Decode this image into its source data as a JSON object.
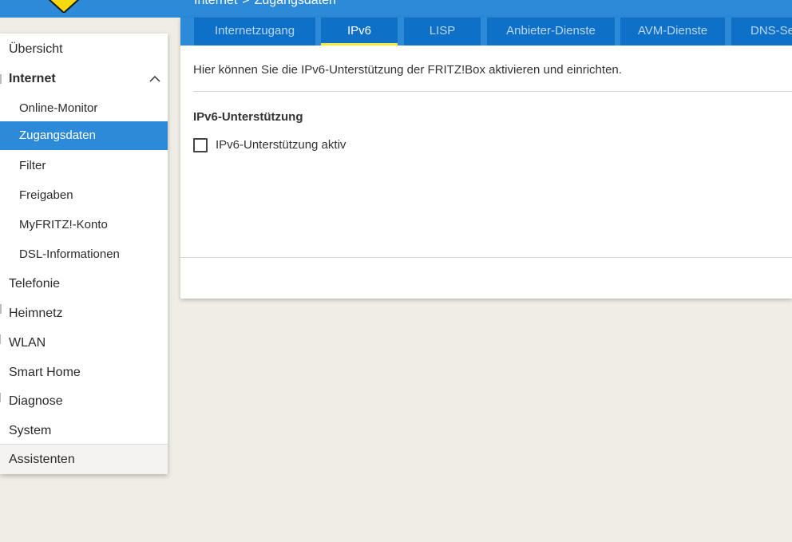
{
  "header": {
    "breadcrumb": {
      "section": "Internet",
      "separator": ">",
      "page": "Zugangsdaten"
    }
  },
  "sidebar": {
    "items": [
      {
        "label": "Übersicht"
      },
      {
        "label": "Internet"
      },
      {
        "label": "Online-Monitor"
      },
      {
        "label": "Zugangsdaten"
      },
      {
        "label": "Filter"
      },
      {
        "label": "Freigaben"
      },
      {
        "label": "MyFRITZ!-Konto"
      },
      {
        "label": "DSL-Informationen"
      },
      {
        "label": "Telefonie"
      },
      {
        "label": "Heimnetz"
      },
      {
        "label": "WLAN"
      },
      {
        "label": "Smart Home"
      },
      {
        "label": "Diagnose"
      },
      {
        "label": "System"
      }
    ],
    "assistant_label": "Assistenten"
  },
  "tabs": [
    {
      "label": "Internetzugang"
    },
    {
      "label": "IPv6"
    },
    {
      "label": "LISP"
    },
    {
      "label": "Anbieter-Dienste"
    },
    {
      "label": "AVM-Dienste"
    },
    {
      "label": "DNS-Server"
    }
  ],
  "main": {
    "intro": "Hier können Sie die IPv6-Unterstützung der FRITZ!Box aktivieren und einrichten.",
    "section_title": "IPv6-Unterstützung",
    "checkbox_label": "IPv6-Unterstützung aktiv",
    "checkbox_checked": false
  },
  "colors": {
    "brand_blue": "#2d8ad8",
    "tab_blue": "#0f70c8",
    "active_underline": "#f6e73a",
    "page_background": "#f0ede6"
  }
}
